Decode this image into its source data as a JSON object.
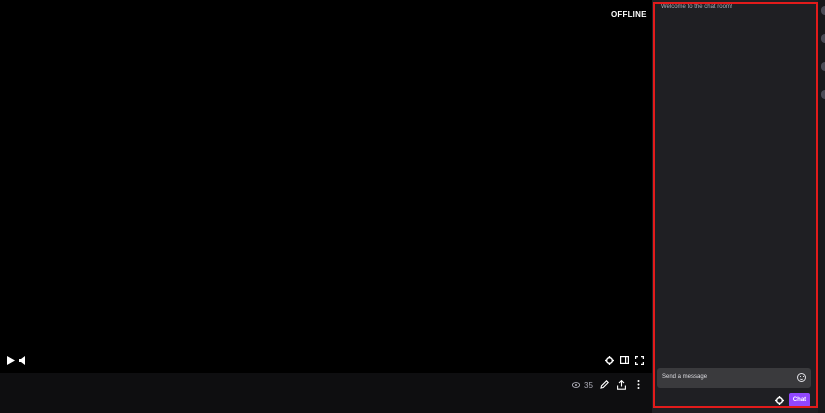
{
  "player": {
    "status": "OFFLINE",
    "icons": {
      "play": "play-icon",
      "volume": "volume-icon",
      "settings": "gear-icon",
      "theatre": "theatre-mode-icon",
      "fullscreen": "fullscreen-icon"
    }
  },
  "infobar": {
    "viewer_count": "35",
    "icons": {
      "viewers": "eye-icon",
      "edit": "pencil-icon",
      "share": "share-icon",
      "more": "more-vertical-icon"
    }
  },
  "chat": {
    "welcome_message": "Welcome to the chat room!",
    "input_placeholder": "Send a message",
    "send_label": "Chat",
    "icons": {
      "emote": "emote-icon",
      "settings": "gear-icon"
    }
  },
  "colors": {
    "accent": "#9147ff",
    "highlight_border": "#e21b1b",
    "chat_bg": "#1f1f23",
    "player_bg": "#000000"
  }
}
